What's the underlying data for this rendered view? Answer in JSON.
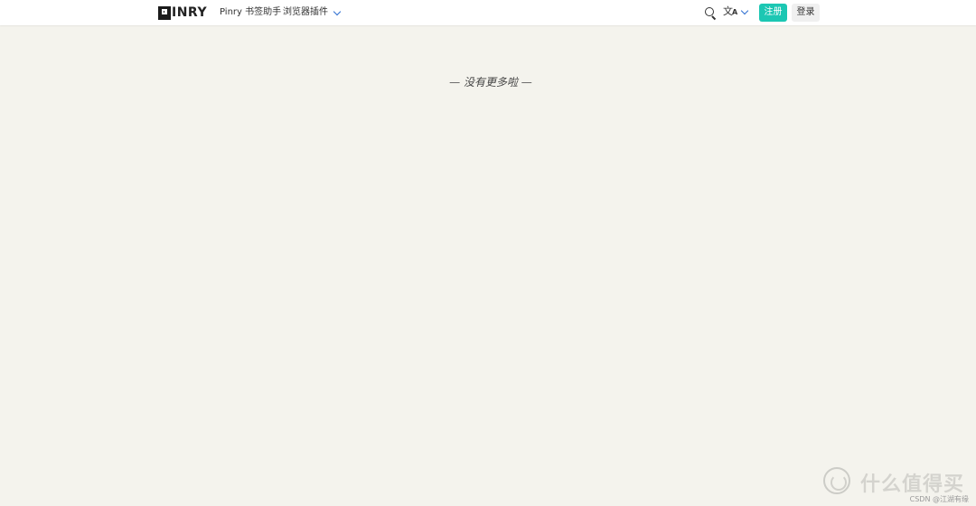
{
  "navbar": {
    "logo_text": "INRY",
    "bookmark_helper": "Pinry 书签助手",
    "browser_plugin": "浏览器插件",
    "register": "注册",
    "login": "登录",
    "translate_icon_glyph": "文",
    "translate_icon_sub": "A",
    "accent_color": "#1cc7b3"
  },
  "main": {
    "end_message": "— 没有更多啦 —"
  },
  "watermark": {
    "brand": "什么值得买",
    "credit": "CSDN @江湖有缘"
  }
}
